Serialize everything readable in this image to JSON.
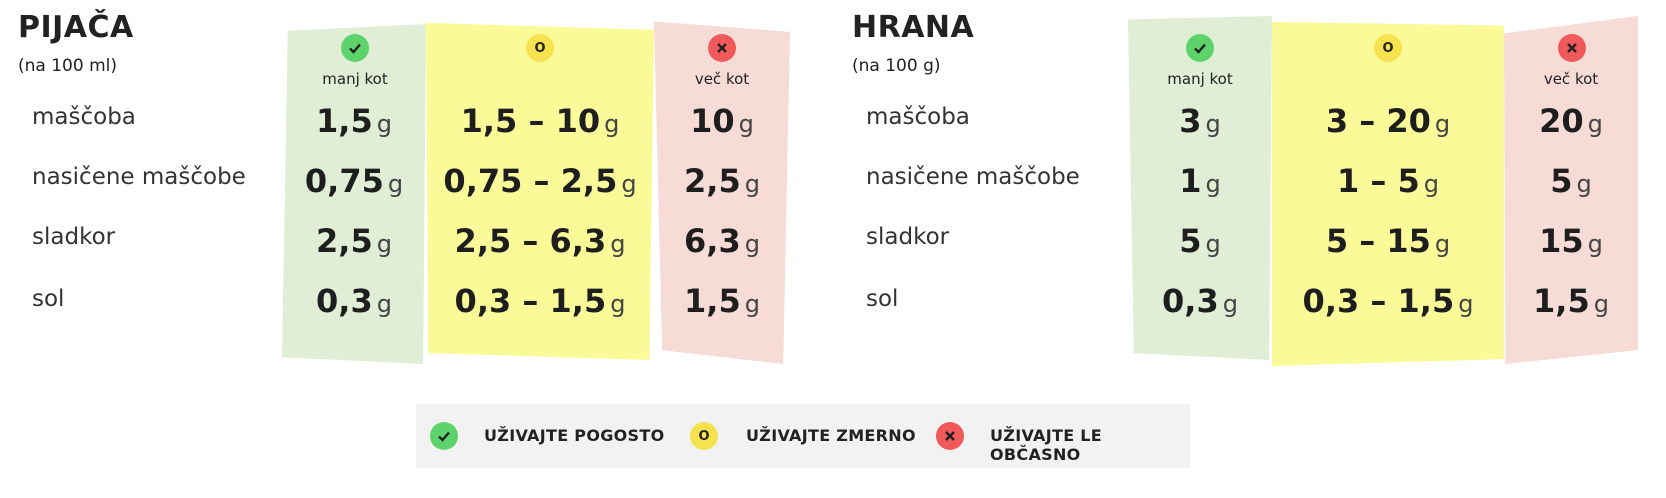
{
  "drinks": {
    "title": "PIJAČA",
    "subtitle": "(na 100 ml)",
    "rows": [
      "maščoba",
      "nasičene maščobe",
      "sladkor",
      "sol"
    ],
    "low_header": "manj kot",
    "high_header": "več kot",
    "low": [
      "1,5",
      "0,75",
      "2,5",
      "0,3"
    ],
    "mid": [
      "1,5 – 10",
      "0,75 – 2,5",
      "2,5 – 6,3",
      "0,3 – 1,5"
    ],
    "high": [
      "10",
      "2,5",
      "6,3",
      "1,5"
    ],
    "unit": "g"
  },
  "food": {
    "title": "HRANA",
    "subtitle": "(na 100 g)",
    "rows": [
      "maščoba",
      "nasičene maščobe",
      "sladkor",
      "sol"
    ],
    "low_header": "manj kot",
    "high_header": "več kot",
    "low": [
      "3",
      "1",
      "5",
      "0,3"
    ],
    "mid": [
      "3 – 20",
      "1 – 5",
      "5 – 15",
      "0,3 – 1,5"
    ],
    "high": [
      "20",
      "5",
      "15",
      "1,5"
    ],
    "unit": "g"
  },
  "icons": {
    "low": "check-icon",
    "mid": "o-icon",
    "mid_glyph": "O",
    "high": "x-icon"
  },
  "legend": {
    "often": "UŽIVAJTE POGOSTO",
    "moderate": "UŽIVAJTE ZMERNO",
    "rarely": "UŽIVAJTE LE OBČASNO"
  },
  "colors": {
    "green_bg": "#dfeed4",
    "yellow_bg": "#fbfa98",
    "red_bg": "#f7dbd6",
    "green_icon": "#5ed36c",
    "yellow_icon": "#f6e14e",
    "red_icon": "#f05a5a"
  }
}
